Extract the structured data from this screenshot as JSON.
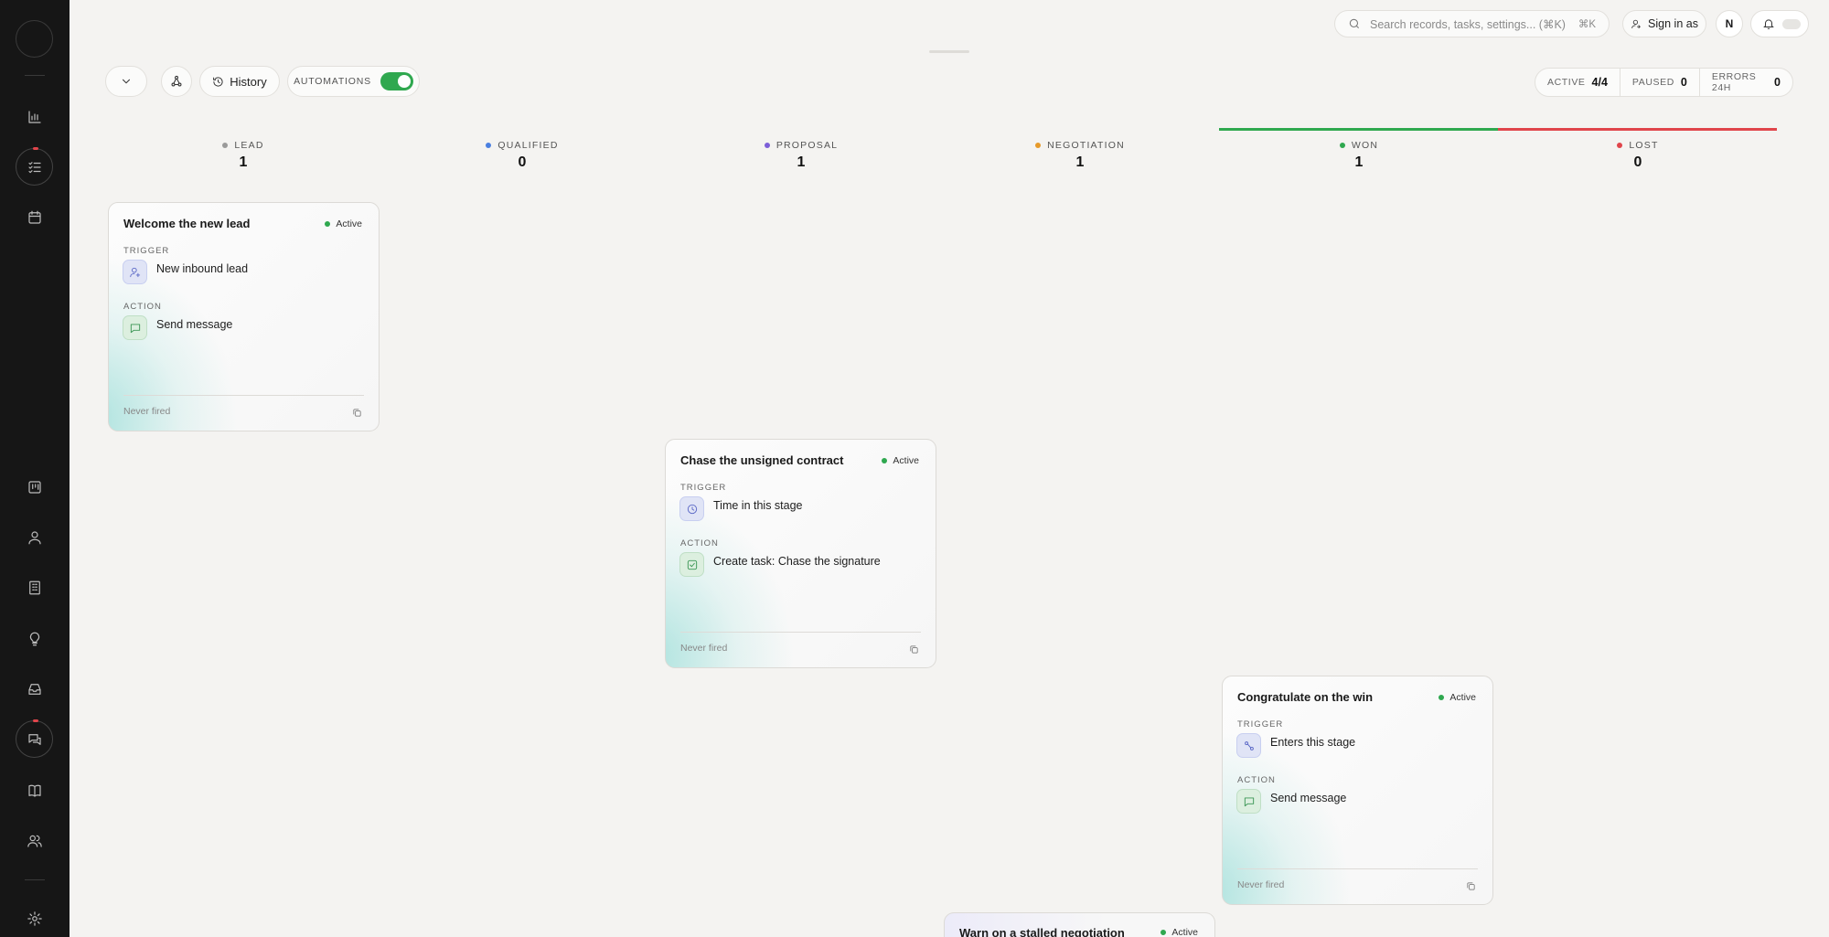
{
  "topbar": {
    "search_placeholder": "Search records, tasks, settings... (⌘K)",
    "search_kbd": "⌘K",
    "signin_label": "Sign in as",
    "avatar_initial": "N"
  },
  "toolbar": {
    "history_label": "History",
    "automations_label": "AUTOMATIONS",
    "automations_enabled": true
  },
  "stats": {
    "active_label": "ACTIVE",
    "active_value": "4/4",
    "paused_label": "PAUSED",
    "paused_value": "0",
    "errors_label": "ERRORS 24H",
    "errors_value": "0"
  },
  "stages": [
    {
      "name": "LEAD",
      "count": "1",
      "color": "#9a9a9a"
    },
    {
      "name": "QUALIFIED",
      "count": "0",
      "color": "#4a7fe0"
    },
    {
      "name": "PROPOSAL",
      "count": "1",
      "color": "#7c5fd8"
    },
    {
      "name": "NEGOTIATION",
      "count": "1",
      "color": "#e69a2a"
    },
    {
      "name": "WON",
      "count": "1",
      "color": "#2fa84f"
    },
    {
      "name": "LOST",
      "count": "0",
      "color": "#e0454b"
    }
  ],
  "sidebar": {
    "icons": [
      "logo",
      "chart-icon",
      "tasks-icon",
      "calendar-icon",
      "board-icon",
      "user-icon",
      "building-icon",
      "lightbulb-icon",
      "inbox-icon",
      "chat-icon",
      "book-icon",
      "users-icon",
      "settings-icon"
    ]
  },
  "cards": [
    {
      "title": "Welcome the new lead",
      "status": "Active",
      "trigger_label": "TRIGGER",
      "trigger": "New inbound lead",
      "action_label": "ACTION",
      "action": "Send message",
      "footer": "Never fired"
    },
    {
      "title": "Chase the unsigned contract",
      "status": "Active",
      "trigger_label": "TRIGGER",
      "trigger": "Time in this stage",
      "action_label": "ACTION",
      "action": "Create task: Chase the signature",
      "footer": "Never fired"
    },
    {
      "title": "Congratulate on the win",
      "status": "Active",
      "trigger_label": "TRIGGER",
      "trigger": "Enters this stage",
      "action_label": "ACTION",
      "action": "Send message",
      "footer": "Never fired"
    },
    {
      "title": "Warn on a stalled negotiation",
      "status": "Active"
    }
  ]
}
